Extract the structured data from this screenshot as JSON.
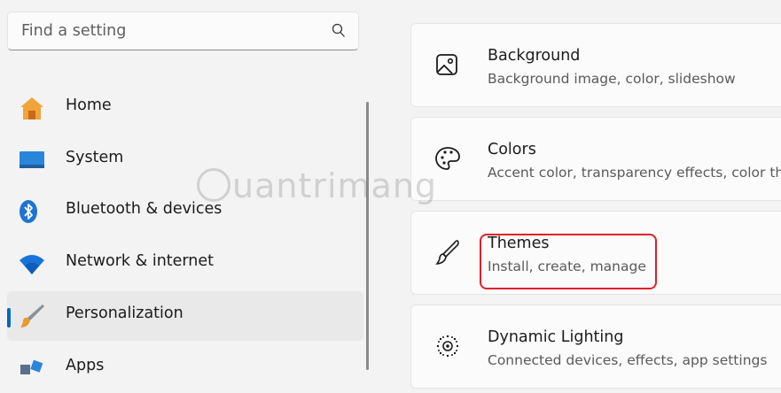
{
  "search": {
    "placeholder": "Find a setting",
    "icon": "search-icon"
  },
  "sidebar": {
    "items": [
      {
        "label": "Home",
        "icon": "home-icon"
      },
      {
        "label": "System",
        "icon": "system-icon"
      },
      {
        "label": "Bluetooth & devices",
        "icon": "bluetooth-icon"
      },
      {
        "label": "Network & internet",
        "icon": "wifi-icon"
      },
      {
        "label": "Personalization",
        "icon": "brush-icon",
        "selected": true
      },
      {
        "label": "Apps",
        "icon": "apps-icon"
      }
    ]
  },
  "main": {
    "cards": [
      {
        "title": "Background",
        "subtitle": "Background image, color, slideshow",
        "icon": "image-icon"
      },
      {
        "title": "Colors",
        "subtitle": "Accent color, transparency effects, color th",
        "icon": "palette-icon"
      },
      {
        "title": "Themes",
        "subtitle": "Install, create, manage",
        "icon": "brush-outline-icon"
      },
      {
        "title": "Dynamic Lighting",
        "subtitle": "Connected devices, effects, app settings",
        "icon": "lighting-icon"
      }
    ]
  },
  "watermark": "uantrimang",
  "colors": {
    "accent": "#0067c0",
    "highlight": "#e0202a"
  }
}
